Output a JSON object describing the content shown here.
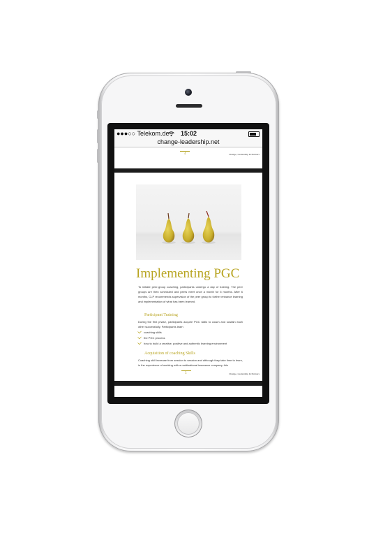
{
  "status_bar": {
    "carrier": "●●●○○ Telekom.de",
    "wifi_icon": "wifi-icon",
    "time": "15:02",
    "battery_icon": "battery-icon"
  },
  "browser": {
    "url": "change-leadership.net"
  },
  "prev_page": {
    "number": "4",
    "running_head": "Change, Leadership & Partners"
  },
  "page": {
    "title": "Implementing PGC",
    "intro": "To initiate peer-group coaching, participants undergo a day of training. The peer groups are then scheduled and peers meet once a month for 6 months. After 6 months, CLP recommends supervision of the peer group to further enhance learning and implementation of what has been learned.",
    "section1_title": "Participant Training",
    "section1_text": "During the first phase, participants acquire PGC skills to coach and sustain each other successfully. Participants learn",
    "bullets": [
      "coaching skills",
      "the PGC process",
      "how to build a creative, positive and authentic learning environment"
    ],
    "section2_title": "Acquisition of coaching Skills",
    "section2_text": "Coaching skill increase from session to session and although they take time to learn, in the experience of working with a multinational insurance company, this",
    "number": "5",
    "running_head": "Change, Leadership & Partners"
  }
}
